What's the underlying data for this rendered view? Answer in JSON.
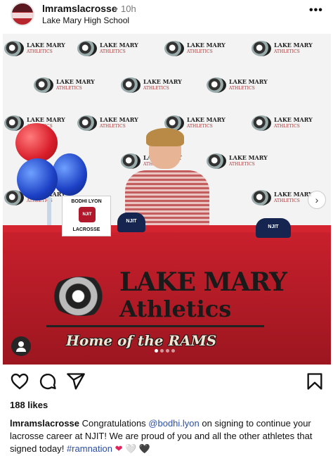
{
  "post": {
    "username": "lmramslacrosse",
    "separator": "•",
    "time": "10h",
    "location": "Lake Mary High School",
    "more_label": "•••"
  },
  "image": {
    "backdrop_logo_text": "LAKE MARY",
    "backdrop_logo_sub": "ATHLETICS",
    "nameplate_name": "BODHI LYON",
    "nameplate_logo": "NJIT",
    "nameplate_sport": "LACROSSE",
    "hat_text": "NJIT",
    "table_title_1": "LAKE MARY",
    "table_title_2": "Athletics",
    "table_subtitle": "Home of the RAMS",
    "next_label": "›",
    "carousel_count": 4,
    "carousel_active": 1
  },
  "actions": {
    "like_icon": "heart-icon",
    "comment_icon": "comment-icon",
    "share_icon": "share-icon",
    "save_icon": "bookmark-icon"
  },
  "likes": "188 likes",
  "caption": {
    "username": "lmramslacrosse",
    "text_1": " Congratulations ",
    "mention": "@bodhi.lyon",
    "text_2": " on signing to continue your lacrosse career at NJIT! We are proud of you and all the other athletes that signed today! ",
    "hashtag": "#ramnation",
    "emojis": "❤ 🤍 🖤"
  },
  "colors": {
    "accent_red": "#c8202c",
    "hat_navy": "#15254f",
    "link_blue": "#2b4ea8"
  }
}
